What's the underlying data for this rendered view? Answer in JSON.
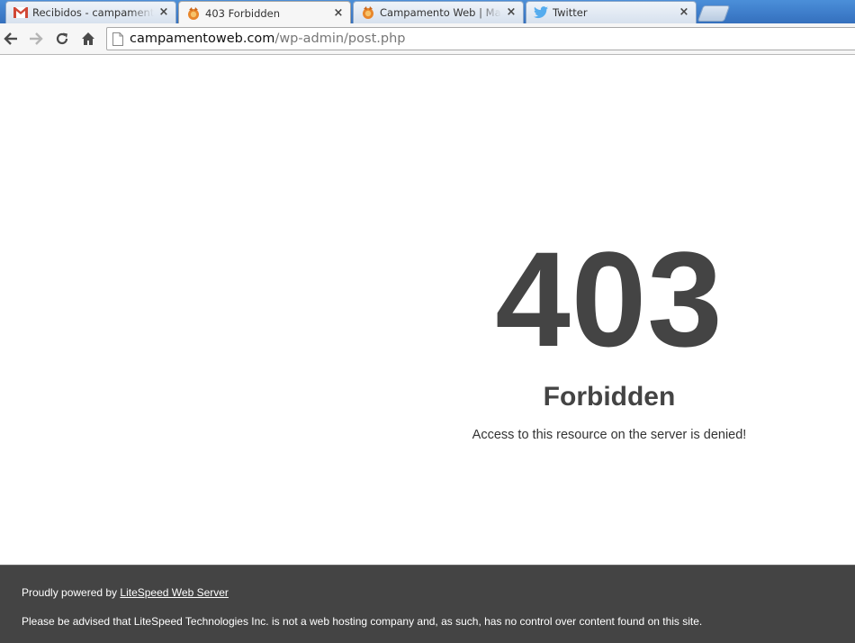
{
  "browser": {
    "tabs": [
      {
        "title": "Recibidos - campamentow",
        "favicon": "gmail-icon",
        "active": false
      },
      {
        "title": "403 Forbidden",
        "favicon": "campamento-web-icon",
        "active": true
      },
      {
        "title": "Campamento Web | Mark",
        "favicon": "campamento-web-icon",
        "active": false
      },
      {
        "title": "Twitter",
        "favicon": "twitter-icon",
        "active": false
      }
    ],
    "close_glyph": "×",
    "address": {
      "host": "campamentoweb.com",
      "path": "/wp-admin/post.php"
    },
    "nav_icons": [
      "back-arrow-icon",
      "forward-arrow-icon",
      "reload-icon",
      "home-icon"
    ]
  },
  "page": {
    "code": "403",
    "title": "Forbidden",
    "description": "Access to this resource on the server is denied!"
  },
  "footer": {
    "powered_prefix": "Proudly powered by ",
    "powered_link": "LiteSpeed Web Server",
    "disclaimer": "Please be advised that LiteSpeed Technologies Inc. is not a web hosting company and, as such, has no control over content found on this site."
  },
  "colors": {
    "tabstrip": "#3d7cc9",
    "text_dark": "#444444",
    "footer_bg": "#444444",
    "gmail_red": "#d14836",
    "twitter_blue": "#55acee",
    "favicon_orange": "#e8862a"
  }
}
